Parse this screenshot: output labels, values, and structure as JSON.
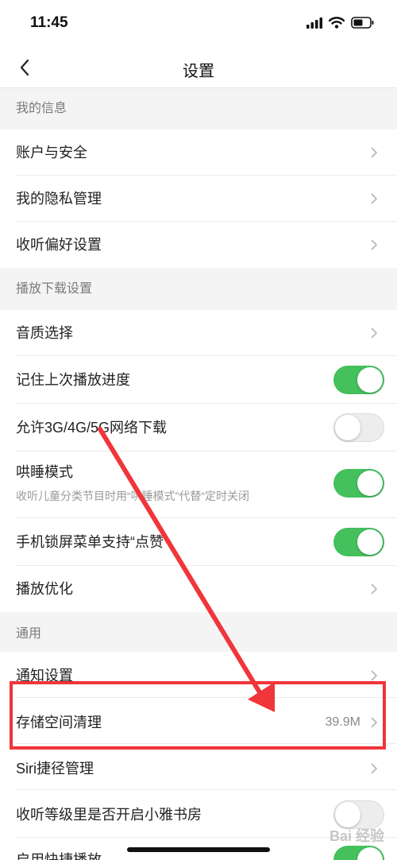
{
  "status_bar": {
    "time": "11:45"
  },
  "header": {
    "title": "设置"
  },
  "sections": {
    "my_info": {
      "title": "我的信息",
      "account_security": "账户与安全",
      "privacy": "我的隐私管理",
      "listening_pref": "收听偏好设置"
    },
    "playback": {
      "title": "播放下载设置",
      "audio_quality": "音质选择",
      "remember_progress": "记住上次播放进度",
      "remember_progress_on": true,
      "mobile_download": "允许3G/4G/5G网络下载",
      "mobile_download_on": false,
      "sleep_mode": "哄睡模式",
      "sleep_mode_desc": "收听儿童分类节目时用“哄睡模式”代替“定时关闭",
      "sleep_mode_on": true,
      "lockscreen_like": "手机锁屏菜单支持“点赞”",
      "lockscreen_like_on": true,
      "optimize": "播放优化"
    },
    "general": {
      "title": "通用",
      "notifications": "通知设置",
      "storage_cleanup": "存储空间清理",
      "storage_size": "39.9M",
      "siri": "Siri捷径管理",
      "study_room": "收听等级里是否开启小雅书房",
      "study_room_on": false,
      "quick_play": "启用快捷播放",
      "quick_play_on": true
    }
  },
  "watermark": "Bai 经验",
  "colors": {
    "toggle_on": "#44c05d",
    "annotation": "#f0353b",
    "background": "#f4f4f4"
  }
}
